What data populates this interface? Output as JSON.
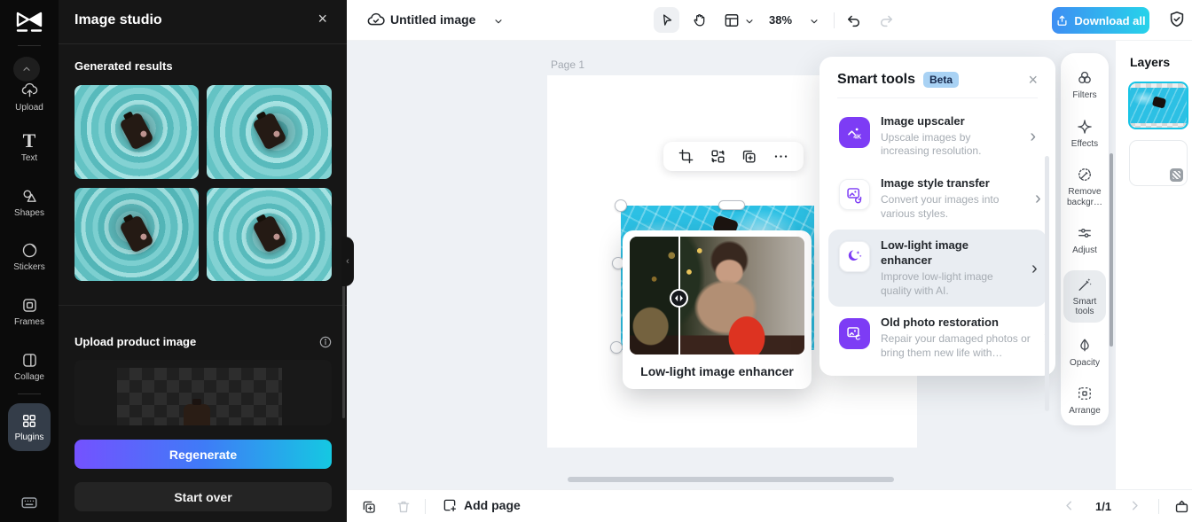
{
  "colors": {
    "accent-purple": "#7d3cf5",
    "accent-cyan": "#19c3e5",
    "beta-bg": "#a9d2f4",
    "beta-text": "#17294d",
    "regenerate-gradient-start": "#7452ff",
    "regenerate-gradient-end": "#15c8e2",
    "download-gradient-start": "#3e8ef3",
    "download-gradient-end": "#27d3ea",
    "layer-selected-border": "#17c4e6"
  },
  "rail": {
    "items": [
      {
        "label": "Upload",
        "icon": "upload-cloud-icon"
      },
      {
        "label": "Text",
        "icon": "text-icon"
      },
      {
        "label": "Shapes",
        "icon": "shapes-icon"
      },
      {
        "label": "Stickers",
        "icon": "stickers-icon"
      },
      {
        "label": "Frames",
        "icon": "frames-icon"
      },
      {
        "label": "Collage",
        "icon": "collage-icon"
      },
      {
        "label": "Plugins",
        "icon": "plugins-icon",
        "active": true
      }
    ]
  },
  "panel": {
    "title": "Image studio",
    "generated_section": "Generated results",
    "upload_section": "Upload product image",
    "regenerate_label": "Regenerate",
    "start_over_label": "Start over"
  },
  "topbar": {
    "project_name": "Untitled image",
    "zoom_level": "38%",
    "download_label": "Download all"
  },
  "canvas": {
    "page_label": "Page 1",
    "preview_card_label": "Low-light image enhancer"
  },
  "smart_tools": {
    "title": "Smart tools",
    "badge": "Beta",
    "items": [
      {
        "title": "Image upscaler",
        "desc": "Upscale images by increasing resolution.",
        "chevron": "›"
      },
      {
        "title": "Image style transfer",
        "desc": "Convert your images into various styles.",
        "chevron": "›"
      },
      {
        "title": "Low-light image enhancer",
        "desc": "Improve low-light image quality with AI.",
        "chevron": "›"
      },
      {
        "title": "Old photo restoration",
        "desc": "Repair your damaged photos or bring them new life with…",
        "chevron": "›"
      }
    ]
  },
  "side_toolbar": {
    "items": [
      {
        "label": "Filters"
      },
      {
        "label": "Effects"
      },
      {
        "label": "Remove backgr…"
      },
      {
        "label": "Adjust"
      },
      {
        "label": "Smart tools",
        "active": true
      },
      {
        "label": "Opacity"
      },
      {
        "label": "Arrange"
      }
    ]
  },
  "layers": {
    "title": "Layers"
  },
  "bottombar": {
    "add_page_label": "Add page",
    "page_indicator": "1/1"
  },
  "glyphs": {
    "close": "×",
    "collapse": "‹",
    "prev": "‹",
    "next": "›"
  }
}
